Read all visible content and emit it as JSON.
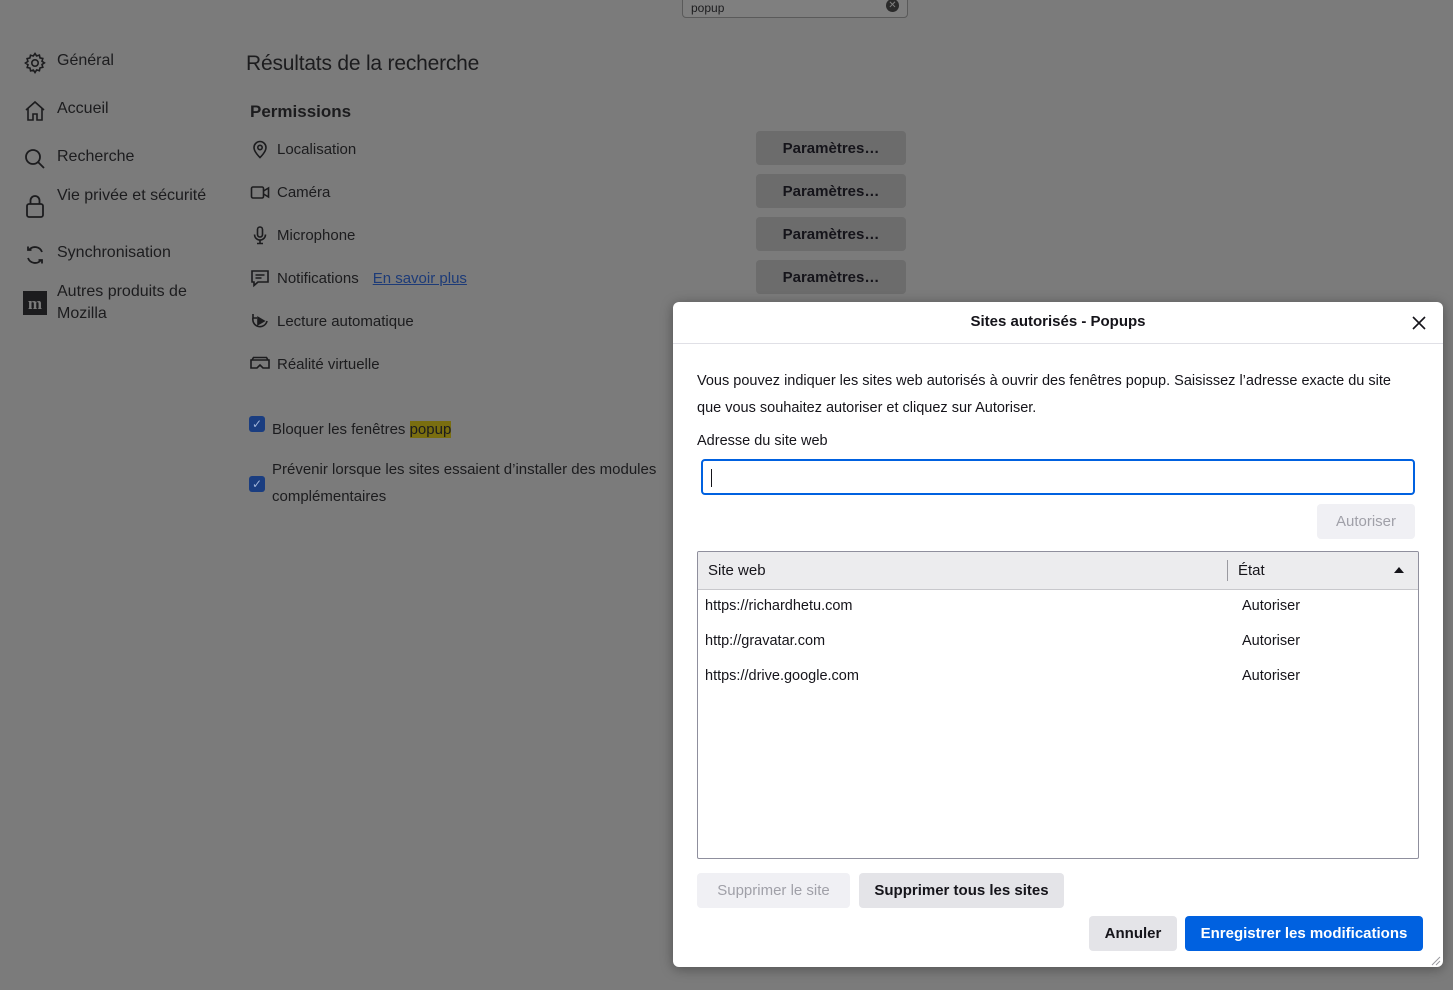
{
  "search": {
    "value": "popup"
  },
  "sidebar": {
    "items": [
      {
        "label": "Général",
        "icon": "gear-icon"
      },
      {
        "label": "Accueil",
        "icon": "home-icon"
      },
      {
        "label": "Recherche",
        "icon": "search-icon"
      },
      {
        "label": "Vie privée et sécurité",
        "icon": "lock-icon"
      },
      {
        "label": "Synchronisation",
        "icon": "sync-icon"
      },
      {
        "label": "Autres produits de Mozilla",
        "icon": "mozilla-icon"
      }
    ]
  },
  "main": {
    "title": "Résultats de la recherche",
    "section": "Permissions",
    "permissions": [
      {
        "label": "Localisation",
        "icon": "location-icon",
        "button": "Paramètres…"
      },
      {
        "label": "Caméra",
        "icon": "camera-icon",
        "button": "Paramètres…"
      },
      {
        "label": "Microphone",
        "icon": "microphone-icon",
        "button": "Paramètres…"
      },
      {
        "label": "Notifications",
        "icon": "notification-icon",
        "button": "Paramètres…",
        "link": "En savoir plus"
      },
      {
        "label": "Lecture automatique",
        "icon": "autoplay-icon"
      },
      {
        "label": "Réalité virtuelle",
        "icon": "vr-icon"
      }
    ],
    "block_popups": {
      "label_before": "Bloquer les fenêtres ",
      "label_highlight": "popup",
      "checked": true
    },
    "warn_addons": {
      "label": "Prévenir lorsque les sites essaient d’installer des modules complémentaires",
      "checked": true
    }
  },
  "dialog": {
    "title": "Sites autorisés - Popups",
    "description": "Vous pouvez indiquer les sites web autorisés à ouvrir des fenêtres popup. Saisissez l’adresse exacte du site que vous souhaitez autoriser et cliquez sur Autoriser.",
    "address_label": "Adresse du site web",
    "address_value": "",
    "allow_button": "Autoriser",
    "table": {
      "col_site": "Site web",
      "col_state": "État",
      "rows": [
        {
          "site": "https://richardhetu.com",
          "state": "Autoriser"
        },
        {
          "site": "http://gravatar.com",
          "state": "Autoriser"
        },
        {
          "site": "https://drive.google.com",
          "state": "Autoriser"
        }
      ]
    },
    "remove_site": "Supprimer le site",
    "remove_all": "Supprimer tous les sites",
    "cancel": "Annuler",
    "save": "Enregistrer les modifications"
  },
  "colors": {
    "accent": "#0061e0",
    "overlay": "#7b7b7b"
  }
}
